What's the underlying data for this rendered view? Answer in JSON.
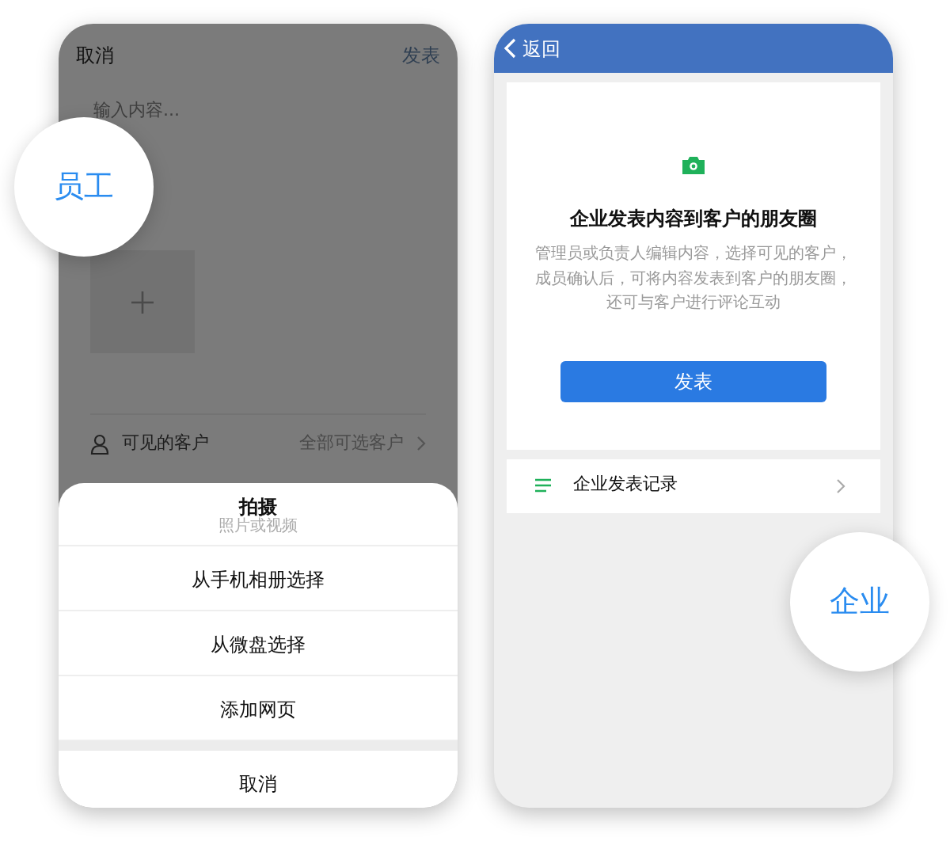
{
  "employee_screen": {
    "badge": "员工",
    "header": {
      "cancel": "取消",
      "publish": "发表"
    },
    "editor": {
      "placeholder": "输入内容..."
    },
    "visible_customers": {
      "label": "可见的客户",
      "value": "全部可选客户"
    },
    "action_sheet": {
      "title": "拍摄",
      "subtitle": "照片或视频",
      "items": [
        "从手机相册选择",
        "从微盘选择",
        "添加网页"
      ],
      "cancel": "取消"
    }
  },
  "enterprise_screen": {
    "badge": "企业",
    "back": "返回",
    "card": {
      "title": "企业发表内容到客户的朋友圈",
      "description": "管理员或负责人编辑内容，选择可见的客户，成员确认后，可将内容发表到客户的朋友圈，还可与客户进行评论互动",
      "button": "发表"
    },
    "record_item": "企业发表记录"
  }
}
